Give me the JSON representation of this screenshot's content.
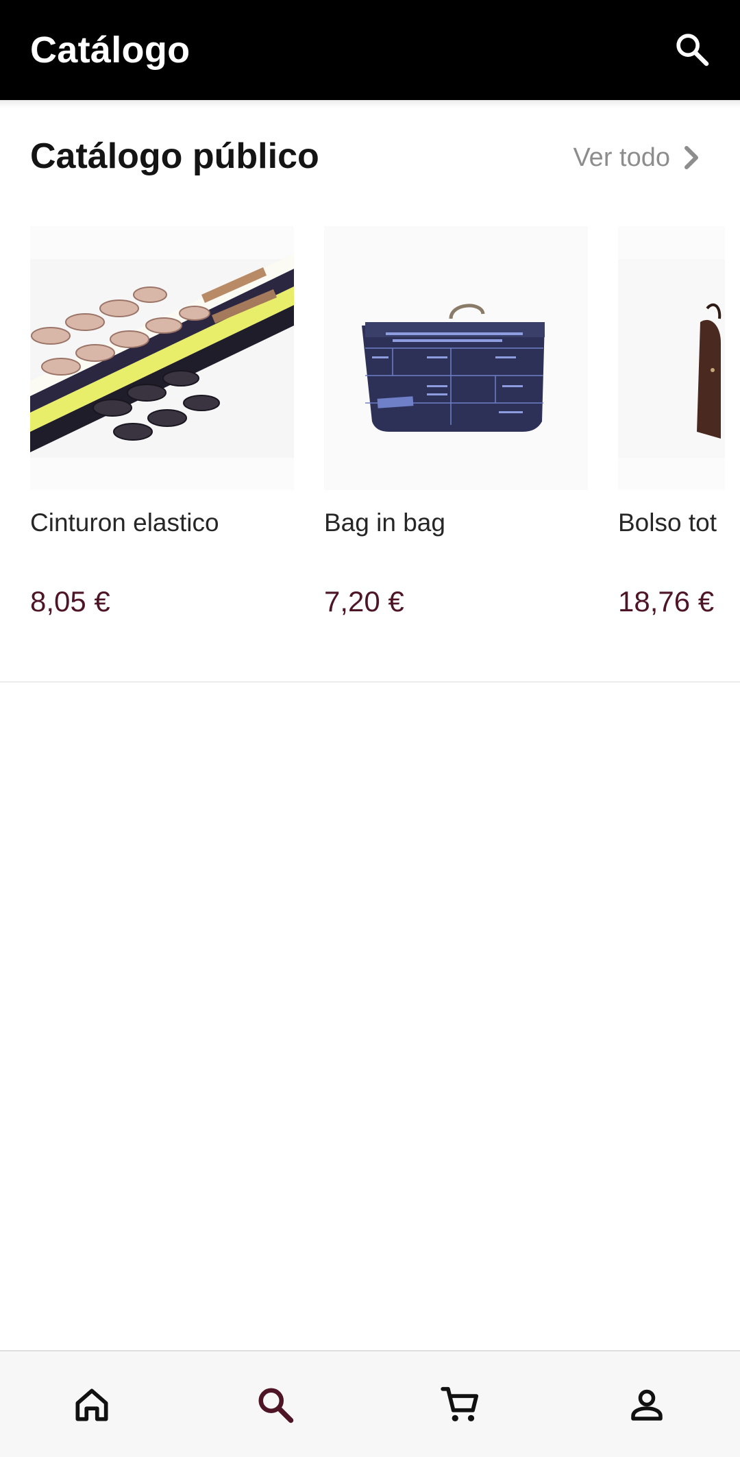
{
  "app_bar": {
    "title": "Catálogo",
    "search_icon": "search-icon"
  },
  "section": {
    "title": "Catálogo público",
    "see_all_label": "Ver todo",
    "see_all_icon": "chevron-right-icon"
  },
  "products": [
    {
      "name": "Cinturon elastico",
      "price": "8,05 €"
    },
    {
      "name": "Bag in bag",
      "price": "7,20 €"
    },
    {
      "name": "Bolso tot",
      "price": "18,76 €"
    }
  ],
  "bottom_nav": {
    "items": [
      {
        "icon": "home-icon",
        "active": false
      },
      {
        "icon": "search-icon",
        "active": true
      },
      {
        "icon": "cart-icon",
        "active": false
      },
      {
        "icon": "account-icon",
        "active": false
      }
    ]
  },
  "colors": {
    "app_bar": "#000000",
    "price": "#4d1526",
    "active_nav": "#4d1526",
    "muted_text": "#8d8d8d"
  }
}
